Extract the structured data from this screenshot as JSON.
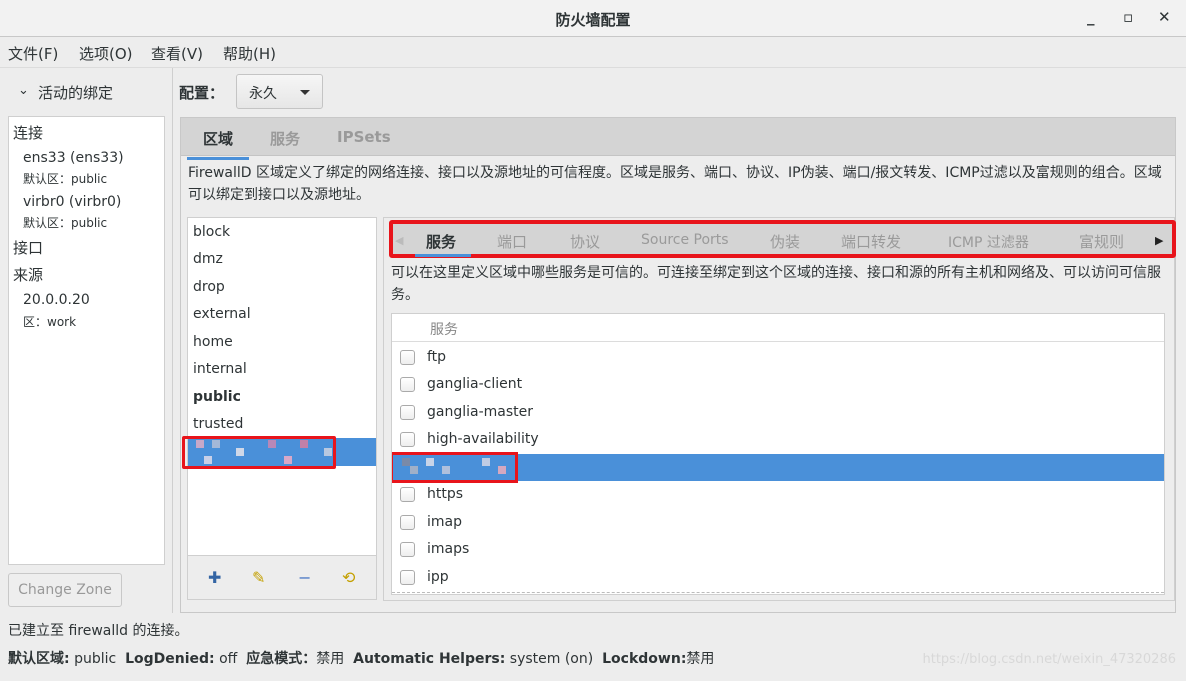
{
  "window": {
    "title": "防火墙配置",
    "minimize": "_",
    "maximize": "▫",
    "close": "✕"
  },
  "menu": [
    "文件(F)",
    "选项(O)",
    "查看(V)",
    "帮助(H)"
  ],
  "sidebar": {
    "header": "活动的绑定",
    "connections_label": "连接",
    "connections": [
      {
        "name": "ens33 (ens33)",
        "zone": "默认区：public"
      },
      {
        "name": "virbr0 (virbr0)",
        "zone": "默认区：public"
      }
    ],
    "interfaces_label": "接口",
    "sources_label": "来源",
    "sources": [
      {
        "name": "20.0.0.20",
        "zone": "区：work"
      }
    ],
    "change_zone": "Change Zone"
  },
  "config": {
    "label": "配置：",
    "value": "永久"
  },
  "main_tabs": [
    {
      "label": "区域",
      "active": true
    },
    {
      "label": "服务"
    },
    {
      "label": "IPSets"
    }
  ],
  "zone_description": "FirewallD 区域定义了绑定的网络连接、接口以及源地址的可信程度。区域是服务、端口、协议、IP伪装、端口/报文转发、ICMP过滤以及富规则的组合。区域可以绑定到接口以及源地址。",
  "zones": [
    "block",
    "dmz",
    "drop",
    "external",
    "home",
    "internal",
    "public",
    "trusted"
  ],
  "default_zone": "public",
  "zone_tabs": [
    {
      "label": "服务",
      "active": true
    },
    {
      "label": "端口"
    },
    {
      "label": "协议"
    },
    {
      "label": "Source Ports"
    },
    {
      "label": "伪装"
    },
    {
      "label": "端口转发"
    },
    {
      "label": "ICMP 过滤器"
    },
    {
      "label": "富规则"
    }
  ],
  "services_description": "可以在这里定义区域中哪些服务是可信的。可连接至绑定到这个区域的连接、接口和源的所有主机和网络及、可以访问可信服务。",
  "services_header": "服务",
  "services": [
    {
      "name": "ftp",
      "checked": false
    },
    {
      "name": "ganglia-client",
      "checked": false
    },
    {
      "name": "ganglia-master",
      "checked": false
    },
    {
      "name": "high-availability",
      "checked": false
    },
    {
      "name": "",
      "checked": false,
      "selected": true
    },
    {
      "name": "https",
      "checked": false
    },
    {
      "name": "imap",
      "checked": false
    },
    {
      "name": "imaps",
      "checked": false
    },
    {
      "name": "ipp",
      "checked": false
    }
  ],
  "status": {
    "connection": "已建立至 firewalld 的连接。",
    "default_zone_label": "默认区域:",
    "default_zone": "public",
    "logdenied_label": "LogDenied:",
    "logdenied": "off",
    "panic_label": "应急模式：",
    "panic": "禁用",
    "helpers_label": "Automatic Helpers:",
    "helpers": "system (on)",
    "lockdown_label": "Lockdown:",
    "lockdown": "禁用"
  },
  "watermark": "https://blog.csdn.net/weixin_47320286",
  "colors": {
    "selection": "#4a90d9",
    "highlight_box": "#e8141b"
  }
}
